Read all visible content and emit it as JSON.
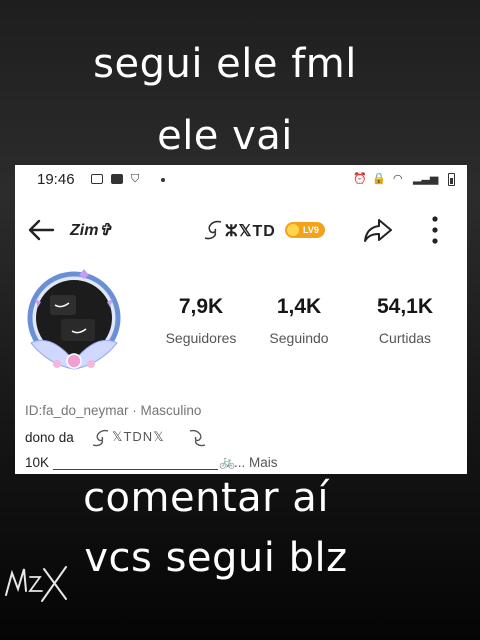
{
  "captions": {
    "line1": "segui ele fml",
    "line2": "ele vai",
    "line3": "comentar aí",
    "line4": "vcs segui blz"
  },
  "statusbar": {
    "time": "19:46"
  },
  "profile": {
    "handle": "Zim✞",
    "display_name": "ⵣ𝕏TD",
    "level_badge": "LV9",
    "stats": [
      {
        "value": "7,9K",
        "label": "Seguidores"
      },
      {
        "value": "1,4K",
        "label": "Seguindo"
      },
      {
        "value": "54,1K",
        "label": "Curtidas"
      }
    ],
    "id_line": "ID:fa_do_neymar · Masculino",
    "bio_line1": "dono da",
    "bio_name": "𝕏TDN𝕏",
    "bio_line2": "10K",
    "bio_emoji": "🚲",
    "more_link": "... Mais"
  },
  "colors": {
    "badge": "#f3a21b",
    "avatar_ring": "#6b8fd6",
    "avatar_accent": "#c79cf0"
  }
}
